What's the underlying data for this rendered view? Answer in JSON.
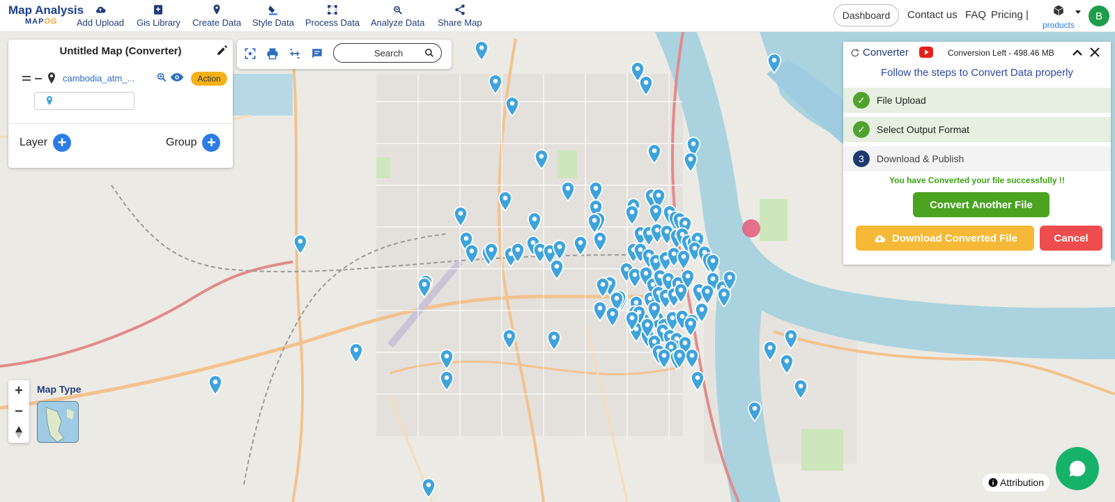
{
  "brand": {
    "title": "Map Analysis",
    "sub_a": "MAP",
    "sub_b": "OG"
  },
  "nav": [
    {
      "label": "Add Upload",
      "icon": "cloud-upload-icon"
    },
    {
      "label": "Gis Library",
      "icon": "library-icon"
    },
    {
      "label": "Create Data",
      "icon": "location-pin-icon"
    },
    {
      "label": "Style Data",
      "icon": "paint-bucket-icon"
    },
    {
      "label": "Process Data",
      "icon": "process-icon"
    },
    {
      "label": "Analyze Data",
      "icon": "analyze-icon"
    },
    {
      "label": "Share Map",
      "icon": "share-icon"
    }
  ],
  "topright": {
    "dashboard": "Dashboard",
    "contact": "Contact us",
    "faq": "FAQ",
    "pricing": "Pricing |",
    "products": "products",
    "avatar": "B"
  },
  "layer_panel": {
    "title": "Untitled Map (Converter)",
    "layer_name": "cambodia_atm_...",
    "action": "Action",
    "layer_label": "Layer",
    "group_label": "Group"
  },
  "toolbar": {
    "search_placeholder": "Search"
  },
  "converter": {
    "title": "Converter",
    "conversion_left": "Conversion Left - 498.46 MB",
    "subtitle": "Follow the steps to Convert Data properly",
    "steps": [
      {
        "label": "File Upload",
        "status": "done"
      },
      {
        "label": "Select Output Format",
        "status": "done"
      },
      {
        "label": "Download & Publish",
        "status": "current",
        "number": "3"
      }
    ],
    "success": "You have Converted your file successfully !!",
    "convert_another": "Convert Another File",
    "download": "Download Converted File",
    "cancel": "Cancel"
  },
  "map_controls": {
    "zoom_in": "+",
    "zoom_out": "−",
    "map_type": "Map Type",
    "attribution": "Attribution"
  },
  "colors": {
    "brand": "#1a3f8f",
    "accent": "#f2a31c",
    "pin": "#3fa3dc",
    "green": "#4aa321",
    "red": "#ef4d4d",
    "yellow": "#f5b937"
  }
}
